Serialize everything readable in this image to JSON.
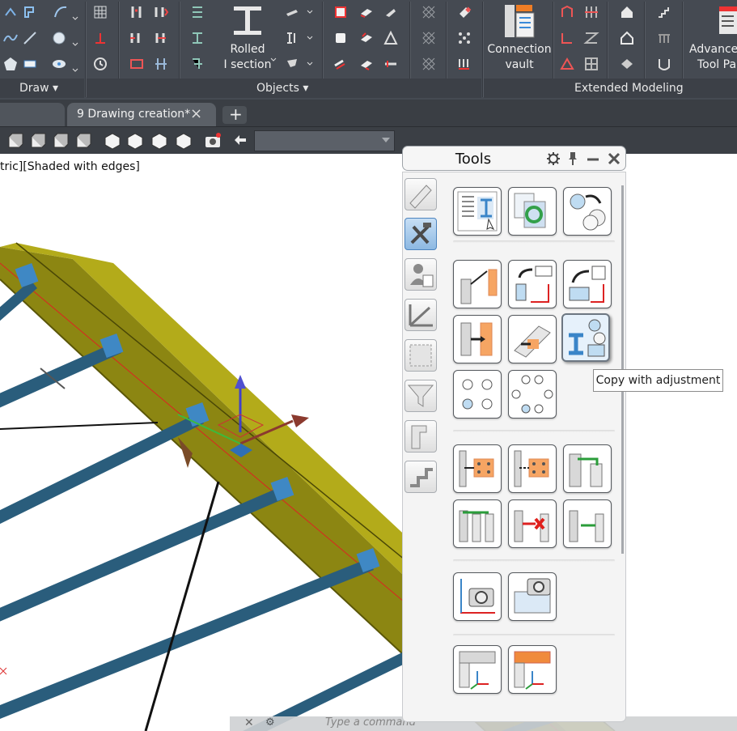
{
  "ribbon": {
    "panels": [
      {
        "label": "Draw"
      },
      {
        "label": "Objects"
      },
      {
        "label": "Extended Modeling"
      }
    ],
    "big_buttons": {
      "rolled_section": {
        "line1": "Rolled",
        "line2": "I section"
      },
      "connection_vault": {
        "line1": "Connection",
        "line2": "vault"
      },
      "advanced_tool_palette": {
        "line1": "Advance",
        "line2": "Tool Pa"
      }
    }
  },
  "tabs": {
    "active": "9 Drawing creation*",
    "close_icon": "×",
    "new_tab_icon": "+"
  },
  "viewport": {
    "label": "tric][Shaded with edges]"
  },
  "palette": {
    "title": "Tools",
    "tooltip": "Copy with adjustment"
  },
  "cmdline": {
    "placeholder": "Type a command"
  },
  "colors": {
    "ribbon_bg": "#454a52",
    "beam_olive": "#9a9410",
    "purlin_blue": "#2a5d7c",
    "palette_bg": "#f4f4f4"
  }
}
